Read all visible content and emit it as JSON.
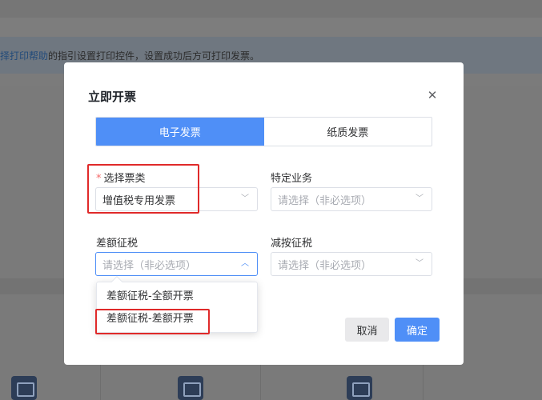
{
  "background": {
    "notice_link": "择打印帮助",
    "notice_text": "的指引设置打印控件，设置成功后方可打印发票。"
  },
  "dialog": {
    "title": "立即开票",
    "close_symbol": "✕",
    "tabs": [
      {
        "label": "电子发票",
        "active": true
      },
      {
        "label": "纸质发票",
        "active": false
      }
    ],
    "fields": {
      "invoice_type": {
        "label": "选择票类",
        "required_mark": "*",
        "value": "增值税专用发票"
      },
      "special_business": {
        "label": "特定业务",
        "placeholder": "请选择（非必选项）"
      },
      "differential_tax": {
        "label": "差额征税",
        "placeholder": "请选择（非必选项）"
      },
      "reduced_tax": {
        "label": "减按征税",
        "placeholder": "请选择（非必选项）"
      }
    },
    "dropdown_options": [
      "差额征税-全额开票",
      "差额征税-差额开票"
    ],
    "buttons": {
      "cancel": "取消",
      "confirm": "确定"
    }
  },
  "colors": {
    "primary": "#4f8ff7",
    "highlight": "#e02a2a",
    "required": "#f56c6c"
  }
}
